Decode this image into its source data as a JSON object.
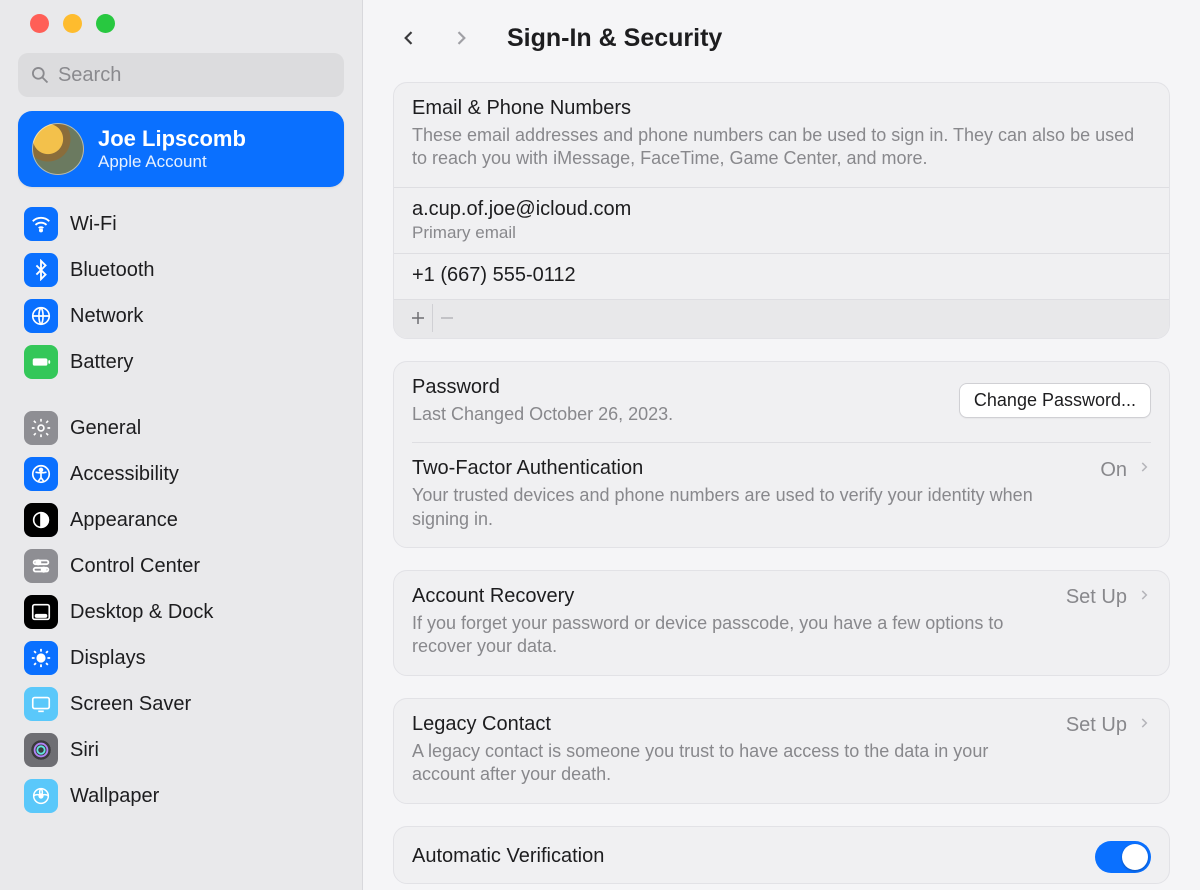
{
  "header": {
    "title": "Sign-In & Security"
  },
  "search": {
    "placeholder": "Search"
  },
  "account": {
    "name": "Joe Lipscomb",
    "sub": "Apple Account"
  },
  "sidebar": {
    "items": [
      {
        "label": "Wi-Fi"
      },
      {
        "label": "Bluetooth"
      },
      {
        "label": "Network"
      },
      {
        "label": "Battery"
      },
      {
        "label": "General"
      },
      {
        "label": "Accessibility"
      },
      {
        "label": "Appearance"
      },
      {
        "label": "Control Center"
      },
      {
        "label": "Desktop & Dock"
      },
      {
        "label": "Displays"
      },
      {
        "label": "Screen Saver"
      },
      {
        "label": "Siri"
      },
      {
        "label": "Wallpaper"
      }
    ]
  },
  "email_section": {
    "title": "Email & Phone Numbers",
    "desc": "These email addresses and phone numbers can be used to sign in. They can also be used to reach you with iMessage, FaceTime, Game Center, and more.",
    "email": "a.cup.of.joe@icloud.com",
    "email_sub": "Primary email",
    "phone": "+1 (667) 555-0112"
  },
  "password_section": {
    "title": "Password",
    "desc": "Last Changed October 26, 2023.",
    "button": "Change Password..."
  },
  "twofa_section": {
    "title": "Two-Factor Authentication",
    "desc": "Your trusted devices and phone numbers are used to verify your identity when signing in.",
    "status": "On"
  },
  "recovery_section": {
    "title": "Account Recovery",
    "desc": "If you forget your password or device passcode, you have a few options to recover your data.",
    "status": "Set Up"
  },
  "legacy_section": {
    "title": "Legacy Contact",
    "desc": "A legacy contact is someone you trust to have access to the data in your account after your death.",
    "status": "Set Up"
  },
  "autoverify_section": {
    "title": "Automatic Verification"
  }
}
